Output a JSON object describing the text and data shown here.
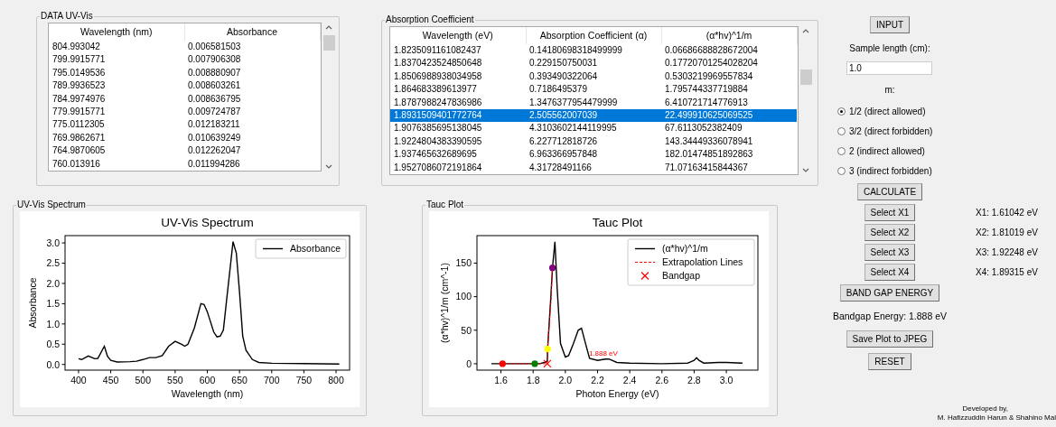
{
  "uv_data": {
    "title": "DATA UV-Vis",
    "columns": [
      "Wavelength (nm)",
      "Absorbance"
    ],
    "rows": [
      {
        "cells": [
          "804.993042",
          "0.006581503"
        ],
        "selected": false
      },
      {
        "cells": [
          "799.9915771",
          "0.007906308"
        ],
        "selected": false
      },
      {
        "cells": [
          "795.0149536",
          "0.008880907"
        ],
        "selected": false
      },
      {
        "cells": [
          "789.9936523",
          "0.008603261"
        ],
        "selected": false
      },
      {
        "cells": [
          "784.9974976",
          "0.008636795"
        ],
        "selected": false
      },
      {
        "cells": [
          "779.9915771",
          "0.009724787"
        ],
        "selected": false
      },
      {
        "cells": [
          "775.0112305",
          "0.012183211"
        ],
        "selected": false
      },
      {
        "cells": [
          "769.9862671",
          "0.010639249"
        ],
        "selected": false
      },
      {
        "cells": [
          "764.9870605",
          "0.012262047"
        ],
        "selected": false
      },
      {
        "cells": [
          "760.013916",
          "0.011994286"
        ],
        "selected": false
      }
    ]
  },
  "absorption": {
    "title": "Absorption Coefficient",
    "columns": [
      "Wavelength (eV)",
      "Absorption Coefficient (α)",
      "(α*hv)^1/m"
    ],
    "rows": [
      {
        "cells": [
          "1.8235091161082437",
          "0.14180698318499999",
          "0.06686688828672004"
        ],
        "selected": false
      },
      {
        "cells": [
          "1.8370423524850648",
          "0.229150750031",
          "0.17720701254028204"
        ],
        "selected": false
      },
      {
        "cells": [
          "1.8506988938034958",
          "0.393490322064",
          "0.5303219969557834"
        ],
        "selected": false
      },
      {
        "cells": [
          "1.864683389613977",
          "0.7186495379",
          "1.795744337719884"
        ],
        "selected": false
      },
      {
        "cells": [
          "1.8787988247836986",
          "1.3476377954479999",
          "6.410721714776913"
        ],
        "selected": false
      },
      {
        "cells": [
          "1.8931509401772764",
          "2.505562007039",
          "22.499910625069525"
        ],
        "selected": true
      },
      {
        "cells": [
          "1.9076385695138045",
          "4.3103602144119995",
          "67.6113052382409"
        ],
        "selected": false
      },
      {
        "cells": [
          "1.9224804383390595",
          "6.227712818726",
          "143.34449336078941"
        ],
        "selected": false
      },
      {
        "cells": [
          "1.937465632689695",
          "6.963366957848",
          "182.01474851892863"
        ],
        "selected": false
      },
      {
        "cells": [
          "1.9527086072191864",
          "4.31728491166",
          "71.07163415844367"
        ],
        "selected": false
      }
    ]
  },
  "uv_spectrum": {
    "title": "UV-Vis Spectrum",
    "chart_data": {
      "type": "line",
      "title": "UV-Vis Spectrum",
      "xlabel": "Wavelength (nm)",
      "ylabel": "Absorbance",
      "x": [
        400,
        405,
        415,
        425,
        430,
        440,
        445,
        450,
        460,
        480,
        490,
        500,
        510,
        520,
        530,
        540,
        550,
        560,
        565,
        570,
        580,
        590,
        595,
        600,
        610,
        615,
        620,
        625,
        630,
        640,
        645,
        650,
        655,
        660,
        670,
        680,
        700,
        750,
        805
      ],
      "series": [
        {
          "name": "Absorbance",
          "color": "#000000",
          "line_style": "solid",
          "values": [
            0.14,
            0.12,
            0.21,
            0.14,
            0.15,
            0.45,
            0.2,
            0.1,
            0.06,
            0.07,
            0.08,
            0.12,
            0.17,
            0.17,
            0.22,
            0.45,
            0.57,
            0.5,
            0.45,
            0.5,
            0.9,
            1.5,
            1.48,
            1.3,
            0.8,
            0.68,
            0.7,
            0.85,
            1.6,
            3.03,
            2.75,
            1.8,
            0.7,
            0.35,
            0.12,
            0.05,
            0.03,
            0.02,
            0.01
          ]
        }
      ],
      "xlim": [
        379,
        821
      ],
      "ylim": [
        -0.14,
        3.18
      ],
      "legend": true,
      "xticks": [
        400,
        450,
        500,
        550,
        600,
        650,
        700,
        750,
        800
      ],
      "yticks": [
        {
          "value": 0,
          "label": "0.0"
        },
        {
          "value": 0.5,
          "label": "0.5"
        },
        {
          "value": 1,
          "label": "1.0"
        },
        {
          "value": 1.5,
          "label": "1.5"
        },
        {
          "value": 2,
          "label": "2.0"
        },
        {
          "value": 2.5,
          "label": "2.5"
        },
        {
          "value": 3,
          "label": "3.0"
        }
      ]
    }
  },
  "tauc_plot": {
    "title": "Tauc Plot",
    "chart_data": {
      "type": "line",
      "title": "Tauc Plot",
      "xlabel": "Photon Energy (eV)",
      "ylabel": "(α*hv)^1/m (cm^-1)",
      "x": [
        1.54,
        1.61,
        1.7,
        1.81,
        1.84,
        1.87,
        1.888,
        1.89,
        1.91,
        1.92,
        1.935,
        1.95,
        1.97,
        2.0,
        2.02,
        2.05,
        2.08,
        2.1,
        2.12,
        2.15,
        2.2,
        2.25,
        2.27,
        2.32,
        2.4,
        2.6,
        2.76,
        2.8,
        2.815,
        2.83,
        2.86,
        2.95,
        3.0,
        3.1
      ],
      "series": [
        {
          "name": "(α*hv)^1/m",
          "color": "#000000",
          "line_style": "solid",
          "values": [
            0,
            0,
            0,
            0,
            0,
            2,
            4,
            22,
            100,
            143,
            182,
            110,
            30,
            10,
            12,
            30,
            50,
            53,
            35,
            8,
            5,
            7,
            7,
            2,
            1,
            0,
            1,
            5,
            9,
            5,
            1,
            2,
            2,
            1
          ]
        },
        {
          "name": "Extrapolation Lines",
          "color": "#ff0000",
          "line_style": "dashed",
          "values": [
            null,
            0,
            0,
            0,
            0,
            0,
            0,
            22,
            91,
            143,
            null,
            null,
            null,
            null,
            null,
            null,
            null,
            null,
            null,
            null,
            null,
            null,
            null,
            null,
            null,
            null,
            null,
            null,
            null,
            null,
            null,
            null,
            null,
            null
          ]
        },
        {
          "name": "Bandgap",
          "color": "#ff0000",
          "line_style": "none",
          "marker": "x",
          "values": [
            null,
            null,
            null,
            null,
            null,
            null,
            0,
            null,
            null,
            null,
            null,
            null,
            null,
            null,
            null,
            null,
            null,
            null,
            null,
            null,
            null,
            null,
            null,
            null,
            null,
            null,
            null,
            null,
            null,
            null,
            null,
            null,
            null,
            null
          ]
        },
        {
          "color": "#ff0000",
          "line_style": "none",
          "marker": "o",
          "values": [
            null,
            0,
            null,
            null,
            null,
            null,
            null,
            null,
            null,
            null,
            null,
            null,
            null,
            null,
            null,
            null,
            null,
            null,
            null,
            null,
            null,
            null,
            null,
            null,
            null,
            null,
            null,
            null,
            null,
            null,
            null,
            null,
            null,
            null
          ]
        },
        {
          "color": "#008000",
          "line_style": "none",
          "marker": "o",
          "values": [
            null,
            null,
            null,
            0,
            null,
            null,
            null,
            null,
            null,
            null,
            null,
            null,
            null,
            null,
            null,
            null,
            null,
            null,
            null,
            null,
            null,
            null,
            null,
            null,
            null,
            null,
            null,
            null,
            null,
            null,
            null,
            null,
            null,
            null
          ]
        },
        {
          "color": "#800080",
          "line_style": "none",
          "marker": "o",
          "values": [
            null,
            null,
            null,
            null,
            null,
            null,
            null,
            null,
            null,
            143,
            null,
            null,
            null,
            null,
            null,
            null,
            null,
            null,
            null,
            null,
            null,
            null,
            null,
            null,
            null,
            null,
            null,
            null,
            null,
            null,
            null,
            null,
            null,
            null
          ]
        },
        {
          "color": "#ffff00",
          "line_style": "none",
          "marker": "o",
          "values": [
            null,
            null,
            null,
            null,
            null,
            null,
            null,
            22,
            null,
            null,
            null,
            null,
            null,
            null,
            null,
            null,
            null,
            null,
            null,
            null,
            null,
            null,
            null,
            null,
            null,
            null,
            null,
            null,
            null,
            null,
            null,
            null,
            null,
            null
          ]
        }
      ],
      "xlim": [
        1.451,
        3.196
      ],
      "ylim": [
        -9.5,
        191
      ],
      "legend": true,
      "xticks": [
        1.6,
        1.8,
        {
          "value": 2,
          "label": "2.0"
        },
        2.2,
        2.4,
        2.6,
        2.8,
        {
          "value": 3,
          "label": "3.0"
        }
      ],
      "yticks": [
        0,
        50,
        100,
        150
      ],
      "annotations": [
        {
          "text": "1.888 eV"
        }
      ]
    }
  },
  "controls": {
    "input_button": "INPUT",
    "sample_length_label": "Sample length (cm):",
    "sample_length_value": "1.0",
    "m_label": "m:",
    "m_options": [
      {
        "label": "1/2 (direct allowed)",
        "selected": true
      },
      {
        "label": "3/2 (direct forbidden)",
        "selected": false
      },
      {
        "label": "2 (indirect allowed)",
        "selected": false
      },
      {
        "label": "3 (indirect forbidden)",
        "selected": false
      }
    ],
    "calculate_button": "CALCULATE",
    "select_points": [
      {
        "button": "Select X1",
        "reading": "X1: 1.61042 eV"
      },
      {
        "button": "Select X2",
        "reading": "X2: 1.81019 eV"
      },
      {
        "button": "Select X3",
        "reading": "X3: 1.92248 eV"
      },
      {
        "button": "Select X4",
        "reading": "X4: 1.89315 eV"
      }
    ],
    "band_gap_button": "BAND GAP ENERGY",
    "bandgap_result": "Bandgap Energy: 1.888 eV",
    "save_button": "Save Plot to JPEG",
    "reset_button": "RESET"
  },
  "credits": [
    "Developed by,",
    "M. Hafizzuddin Harun & Shahino Mal"
  ]
}
